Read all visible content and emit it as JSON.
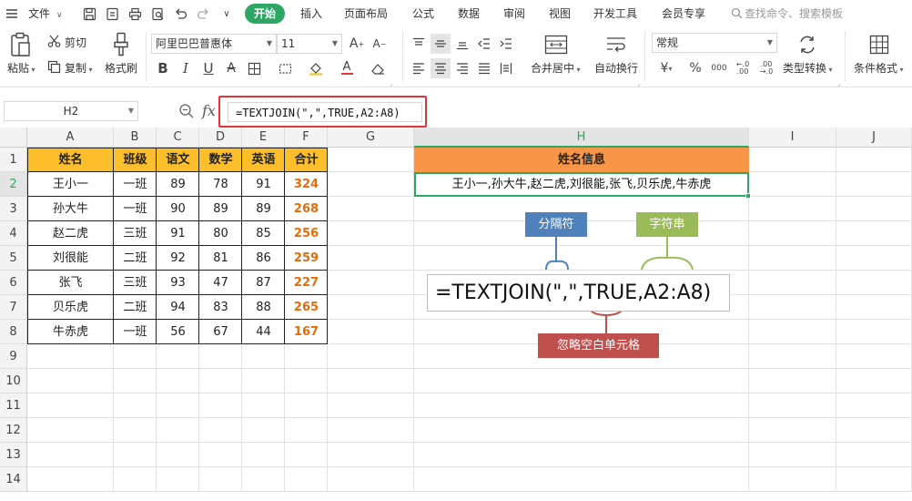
{
  "menu": {
    "file": "文件",
    "tabs": [
      "开始",
      "插入",
      "页面布局",
      "公式",
      "数据",
      "审阅",
      "视图",
      "开发工具",
      "会员专享"
    ],
    "search_placeholder": "查找命令、搜索模板"
  },
  "ribbon": {
    "paste": "粘贴",
    "cut": "剪切",
    "copy": "复制",
    "format_painter": "格式刷",
    "font_name": "阿里巴巴普惠体",
    "font_size": "11",
    "merge_center": "合并居中",
    "wrap_text": "自动换行",
    "number_format": "常规",
    "type_convert": "类型转换",
    "conditional_format": "条件格式",
    "bold": "B",
    "italic": "I",
    "underline": "U",
    "currency": "¥",
    "percent": "%"
  },
  "formula_bar": {
    "cell_ref": "H2",
    "fx": "fx",
    "formula": "=TEXTJOIN(\",\",TRUE,A2:A8)"
  },
  "grid": {
    "columns": [
      "A",
      "B",
      "C",
      "D",
      "E",
      "F",
      "G",
      "H",
      "I",
      "J"
    ],
    "rows": [
      "1",
      "2",
      "3",
      "4",
      "5",
      "6",
      "7",
      "8",
      "9",
      "10",
      "11",
      "12",
      "13",
      "14"
    ],
    "headers": [
      "姓名",
      "班级",
      "语文",
      "数学",
      "英语",
      "合计"
    ],
    "records": [
      [
        "王小一",
        "一班",
        "89",
        "78",
        "91",
        "324"
      ],
      [
        "孙大牛",
        "一班",
        "90",
        "89",
        "89",
        "268"
      ],
      [
        "赵二虎",
        "三班",
        "91",
        "80",
        "85",
        "256"
      ],
      [
        "刘很能",
        "二班",
        "92",
        "81",
        "86",
        "259"
      ],
      [
        "张飞",
        "三班",
        "93",
        "47",
        "87",
        "227"
      ],
      [
        "贝乐虎",
        "二班",
        "94",
        "83",
        "88",
        "265"
      ],
      [
        "牛赤虎",
        "一班",
        "56",
        "67",
        "44",
        "167"
      ]
    ],
    "h1": "姓名信息",
    "h2": "王小一,孙大牛,赵二虎,刘很能,张飞,贝乐虎,牛赤虎"
  },
  "annotation": {
    "separator": "分隔符",
    "string": "字符串",
    "ignore_blank": "忽略空白单元格",
    "formula": "=TEXTJOIN(\",\",TRUE,A2:A8)"
  },
  "colors": {
    "accent_green": "#2fa764",
    "header_yellow": "#fcbf2b",
    "header_orange": "#f79646",
    "total_orange": "#e46c0a",
    "blue_label": "#4f81bd",
    "green_label": "#9bbb59",
    "red_label": "#c0504d",
    "highlight_red": "#e0353a"
  }
}
